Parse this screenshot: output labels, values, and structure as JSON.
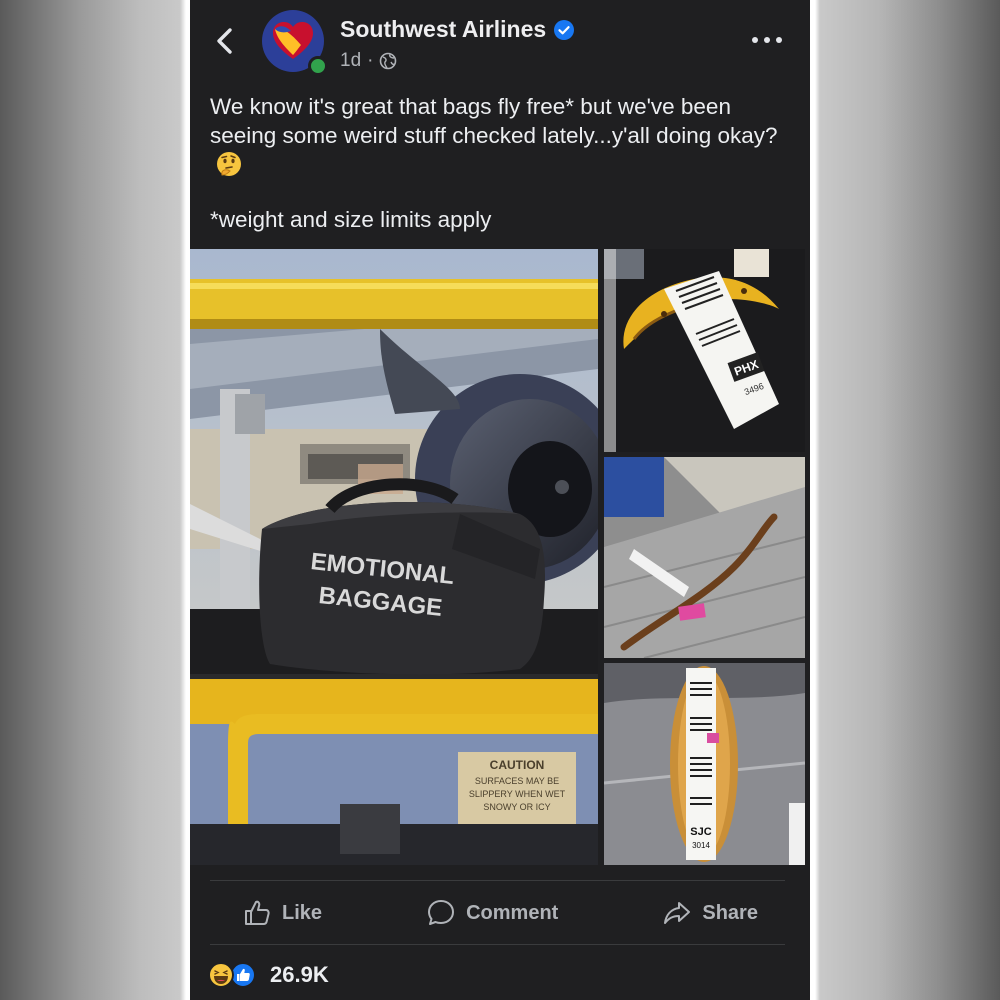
{
  "header": {
    "page_name": "Southwest Airlines",
    "time": "1d",
    "separator": "·",
    "icons": [
      "chevron-left-icon",
      "verified-badge-icon",
      "globe-icon",
      "more-icon"
    ]
  },
  "post": {
    "text": "We know it's great that bags fly free* but we've been seeing some weird stuff checked lately...y'all doing okay?",
    "note": "*weight and size limits apply"
  },
  "photos": {
    "main": {
      "bag_line1": "EMOTIONAL",
      "bag_line2": "BAGGAGE",
      "caution_title": "CAUTION",
      "caution_line1": "SURFACES MAY BE",
      "caution_line2": "SLIPPERY WHEN WET",
      "caution_line3": "SNOWY OR ICY"
    },
    "banana": {
      "tag_code": "PHX",
      "tag_number": "3496"
    },
    "stick": {},
    "bread": {
      "tag_code": "SJC",
      "tag_number": "3014"
    }
  },
  "actions": {
    "like": "Like",
    "comment": "Comment",
    "share": "Share"
  },
  "reactions": {
    "count": "26.9K"
  },
  "colors": {
    "background": "#1f1f21",
    "text": "#e8e8ea",
    "muted": "#b0b3b8",
    "facebook_blue": "#1877f2",
    "online_green": "#31a24c",
    "southwest_blue": "#2c3f99"
  }
}
